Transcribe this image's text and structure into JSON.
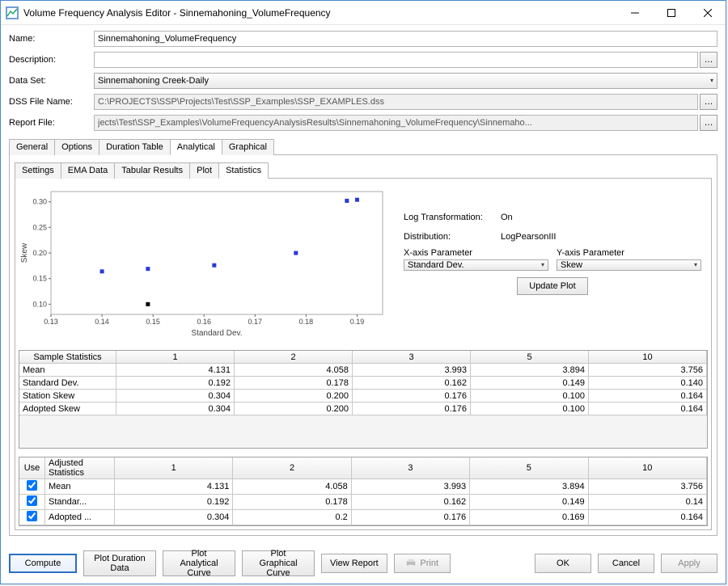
{
  "window": {
    "title": "Volume Frequency Analysis Editor - Sinnemahoning_VolumeFrequency"
  },
  "form": {
    "name_label": "Name:",
    "name_value": "Sinnemahoning_VolumeFrequency",
    "description_label": "Description:",
    "description_value": "",
    "dataset_label": "Data Set:",
    "dataset_value": "Sinnemahoning Creek-Daily",
    "dssfile_label": "DSS File Name:",
    "dssfile_value": "C:\\PROJECTS\\SSP\\Projects\\Test\\SSP_Examples\\SSP_EXAMPLES.dss",
    "reportfile_label": "Report File:",
    "reportfile_value": "jects\\Test\\SSP_Examples\\VolumeFrequencyAnalysisResults\\Sinnemahoning_VolumeFrequency\\Sinnemaho..."
  },
  "tabs": {
    "outer": [
      "General",
      "Options",
      "Duration Table",
      "Analytical",
      "Graphical"
    ],
    "outer_active": "Analytical",
    "inner": [
      "Settings",
      "EMA Data",
      "Tabular Results",
      "Plot",
      "Statistics"
    ],
    "inner_active": "Statistics"
  },
  "plot_controls": {
    "logtrans_label": "Log Transformation:",
    "logtrans_value": "On",
    "dist_label": "Distribution:",
    "dist_value": "LogPearsonIII",
    "xparam_label": "X-axis Parameter",
    "xparam_value": "Standard Dev.",
    "yparam_label": "Y-axis Parameter",
    "yparam_value": "Skew",
    "update_label": "Update Plot"
  },
  "chart_data": {
    "type": "scatter",
    "xlabel": "Standard Dev.",
    "ylabel": "Skew",
    "xlim": [
      0.13,
      0.195
    ],
    "ylim": [
      0.08,
      0.32
    ],
    "xticks": [
      0.13,
      0.14,
      0.15,
      0.16,
      0.17,
      0.18,
      0.19
    ],
    "yticks": [
      0.1,
      0.15,
      0.2,
      0.25,
      0.3
    ],
    "series": [
      {
        "name": "blue",
        "color": "#2a3ad6",
        "points": [
          {
            "x": 0.14,
            "y": 0.164
          },
          {
            "x": 0.149,
            "y": 0.169
          },
          {
            "x": 0.162,
            "y": 0.176
          },
          {
            "x": 0.178,
            "y": 0.2
          },
          {
            "x": 0.188,
            "y": 0.302
          },
          {
            "x": 0.19,
            "y": 0.304
          }
        ]
      },
      {
        "name": "black",
        "color": "#000000",
        "points": [
          {
            "x": 0.149,
            "y": 0.1
          }
        ]
      }
    ]
  },
  "stats_table": {
    "header_label": "Sample Statistics",
    "columns": [
      "1",
      "2",
      "3",
      "5",
      "10"
    ],
    "rows": [
      {
        "label": "Mean",
        "v": [
          "4.131",
          "4.058",
          "3.993",
          "3.894",
          "3.756"
        ]
      },
      {
        "label": "Standard Dev.",
        "v": [
          "0.192",
          "0.178",
          "0.162",
          "0.149",
          "0.140"
        ]
      },
      {
        "label": "Station Skew",
        "v": [
          "0.304",
          "0.200",
          "0.176",
          "0.100",
          "0.164"
        ]
      },
      {
        "label": "Adopted Skew",
        "v": [
          "0.304",
          "0.200",
          "0.176",
          "0.100",
          "0.164"
        ]
      }
    ]
  },
  "adj_table": {
    "use_label": "Use",
    "adj_label": "Adjusted Statistics",
    "columns": [
      "1",
      "2",
      "3",
      "5",
      "10"
    ],
    "rows": [
      {
        "use": true,
        "label": "Mean",
        "v": [
          "4.131",
          "4.058",
          "3.993",
          "3.894",
          "3.756"
        ]
      },
      {
        "use": true,
        "label": "Standar...",
        "v": [
          "0.192",
          "0.178",
          "0.162",
          "0.149",
          "0.14"
        ]
      },
      {
        "use": true,
        "label": "Adopted ...",
        "v": [
          "0.304",
          "0.2",
          "0.176",
          "0.169",
          "0.164"
        ]
      }
    ]
  },
  "buttons": {
    "compute": "Compute",
    "plot_duration": "Plot Duration Data",
    "plot_analytical": "Plot Analytical Curve",
    "plot_graphical": "Plot Graphical Curve",
    "view_report": "View Report",
    "print": "Print",
    "ok": "OK",
    "cancel": "Cancel",
    "apply": "Apply"
  }
}
